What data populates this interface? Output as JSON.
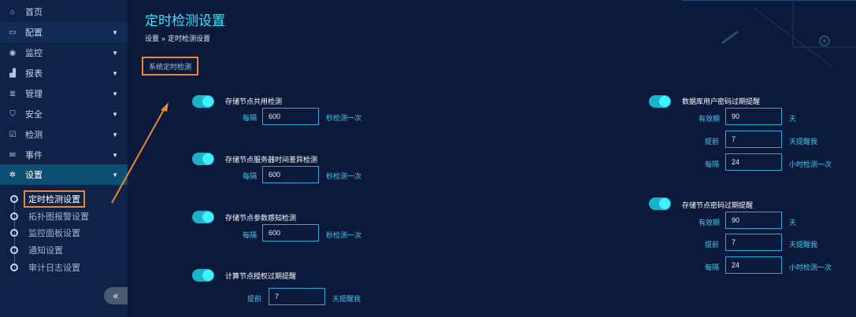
{
  "sidebar": {
    "items": [
      {
        "icon": "home-icon",
        "glyph": "⌂",
        "label": "首页",
        "caret": ""
      },
      {
        "icon": "monitor-icon",
        "glyph": "▭",
        "label": "配置",
        "caret": "▼"
      },
      {
        "icon": "eye-icon",
        "glyph": "◉",
        "label": "监控",
        "caret": "▼"
      },
      {
        "icon": "chart-icon",
        "glyph": "▟",
        "label": "报表",
        "caret": "▼"
      },
      {
        "icon": "database-icon",
        "glyph": "≣",
        "label": "管理",
        "caret": "▼"
      },
      {
        "icon": "shield-icon",
        "glyph": "⛉",
        "label": "安全",
        "caret": "▼"
      },
      {
        "icon": "check-icon",
        "glyph": "☑",
        "label": "检测",
        "caret": "▼"
      },
      {
        "icon": "envelope-icon",
        "glyph": "✉",
        "label": "事件",
        "caret": "▼"
      },
      {
        "icon": "gear-icon",
        "glyph": "✲",
        "label": "设置",
        "caret": "▼"
      }
    ],
    "sub_items": [
      "定时检测设置",
      "拓扑图报警设置",
      "监控面板设置",
      "通知设置",
      "审计日志设置"
    ],
    "collapse_label": "«"
  },
  "header": {
    "title": "定时检测设置",
    "breadcrumb": [
      "设置",
      "»",
      "定时检测设置"
    ]
  },
  "tab_label": "系统定时检测",
  "left_options": [
    {
      "title": "存储节点共用检测",
      "prefix": "每隔",
      "value": "600",
      "suffix": "秒检测一次"
    },
    {
      "title": "存储节点服务器时间差异检测",
      "prefix": "每隔",
      "value": "600",
      "suffix": "秒检测一次"
    },
    {
      "title": "存储节点参数感知检测",
      "prefix": "每隔",
      "value": "600",
      "suffix": "秒检测一次"
    },
    {
      "title": "计算节点授权过期提醒",
      "prefix": "提前",
      "value": "7",
      "suffix": "天提醒我"
    }
  ],
  "right_options": [
    {
      "title": "数据库用户密码过期提醒",
      "rows": [
        {
          "prefix": "有效期",
          "value": "90",
          "suffix": "天"
        },
        {
          "prefix": "提前",
          "value": "7",
          "suffix": "天提醒我"
        },
        {
          "prefix": "每隔",
          "value": "24",
          "suffix": "小时检测一次"
        }
      ]
    },
    {
      "title": "存储节点密码过期提醒",
      "rows": [
        {
          "prefix": "有效期",
          "value": "90",
          "suffix": "天"
        },
        {
          "prefix": "提前",
          "value": "7",
          "suffix": "天提醒我"
        },
        {
          "prefix": "每隔",
          "value": "24",
          "suffix": "小时检测一次"
        }
      ]
    }
  ],
  "colors": {
    "accent": "#33e6ff",
    "highlight_box": "#e8863a",
    "toggle_on": "#1ab3c7"
  }
}
